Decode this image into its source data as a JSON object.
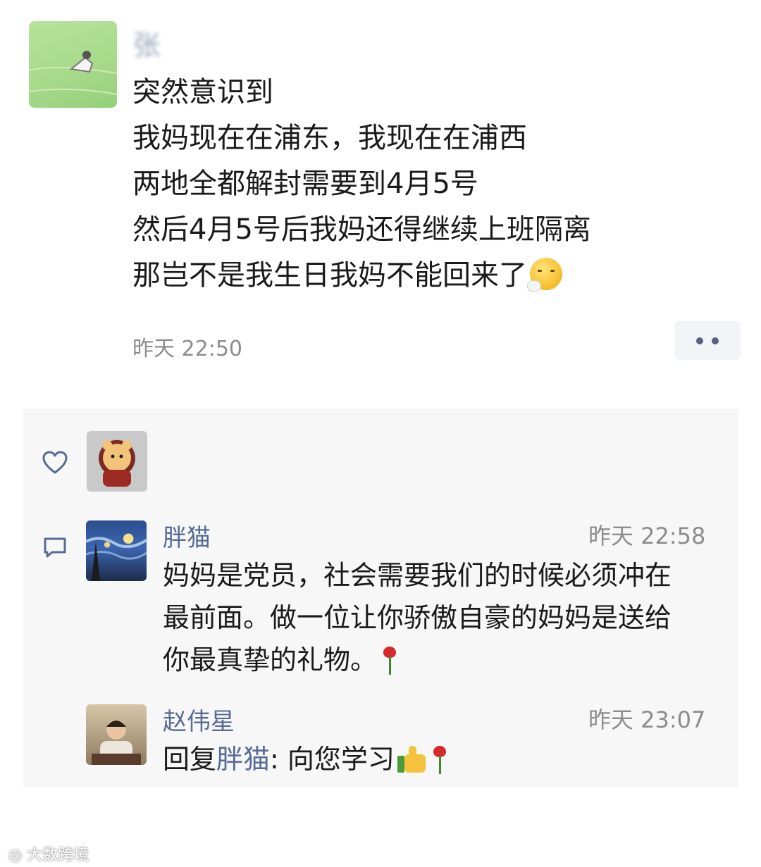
{
  "post": {
    "author": "张",
    "lines": [
      "突然意识到",
      "我妈现在在浦东，我现在在浦西",
      "两地全都解封需要到4月5号",
      "然后4月5号后我妈还得继续上班隔离",
      "那岂不是我生日我妈不能回来了"
    ],
    "emoji": "sad-face-emoji",
    "time": "昨天 22:50"
  },
  "interactions": {
    "like_icon": "heart-icon",
    "comment_icon": "comment-icon",
    "comments": [
      {
        "name": "胖猫",
        "time": "昨天 22:58",
        "lines": [
          "妈妈是党员，社会需要我们的时候必须冲在",
          "最前面。做一位让你骄傲自豪的妈妈是送给",
          "你最真挚的礼物。"
        ],
        "emoji": "rose-emoji"
      },
      {
        "name": "赵伟星",
        "time": "昨天 23:07",
        "reply_prefix": "回复",
        "reply_target": "胖猫",
        "reply_text": ": 向您学习",
        "emojis": [
          "thumbs-up-emoji",
          "rose-emoji"
        ]
      }
    ]
  },
  "watermark": "大数跨境",
  "colors": {
    "link": "#576b95",
    "panel_bg": "#f7f7f7",
    "time_gray": "#8c8c8c"
  }
}
